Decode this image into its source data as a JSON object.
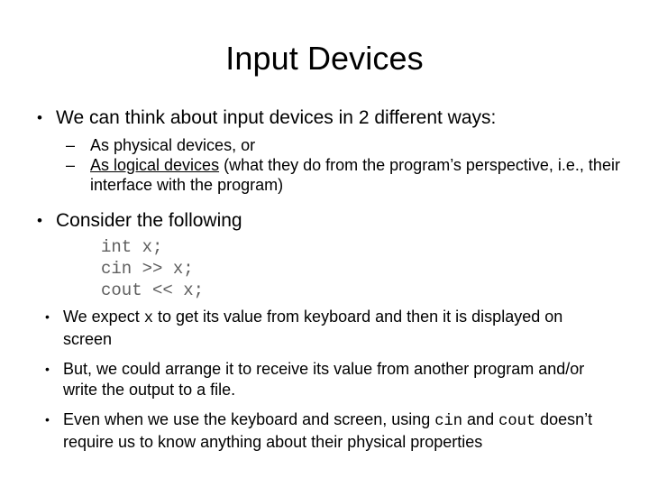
{
  "slide": {
    "title": "Input Devices",
    "background_color": "#ffffff",
    "text_color": "#000000",
    "code_color": "#5e5e5e",
    "bullet_glyph": "•",
    "dash_glyph": "–",
    "blocks": {
      "b1": {
        "text": "We can think about input devices in 2 different ways:"
      },
      "b1s1": {
        "text": "As physical devices, or"
      },
      "b1s2": {
        "underlined": "As logical devices",
        "rest": " (what they do from the program’s perspective, i.e., their interface with the program)"
      },
      "b2": {
        "text": "Consider the following"
      },
      "code": {
        "line1": "int x;",
        "line2": "cin >> x;",
        "line3": "cout << x;"
      },
      "b3": {
        "pre": "We expect ",
        "mono": "x",
        "post": " to get its value from keyboard and then it is displayed on screen"
      },
      "b4": {
        "text": "But, we could arrange it to receive its value from another program and/or write the output to a file."
      },
      "b5": {
        "pre": "Even when we use the keyboard and screen, using ",
        "mono1": "cin",
        "mid": " and ",
        "mono2": "cout",
        "post": " doesn’t require us to know anything about their physical properties"
      }
    }
  }
}
